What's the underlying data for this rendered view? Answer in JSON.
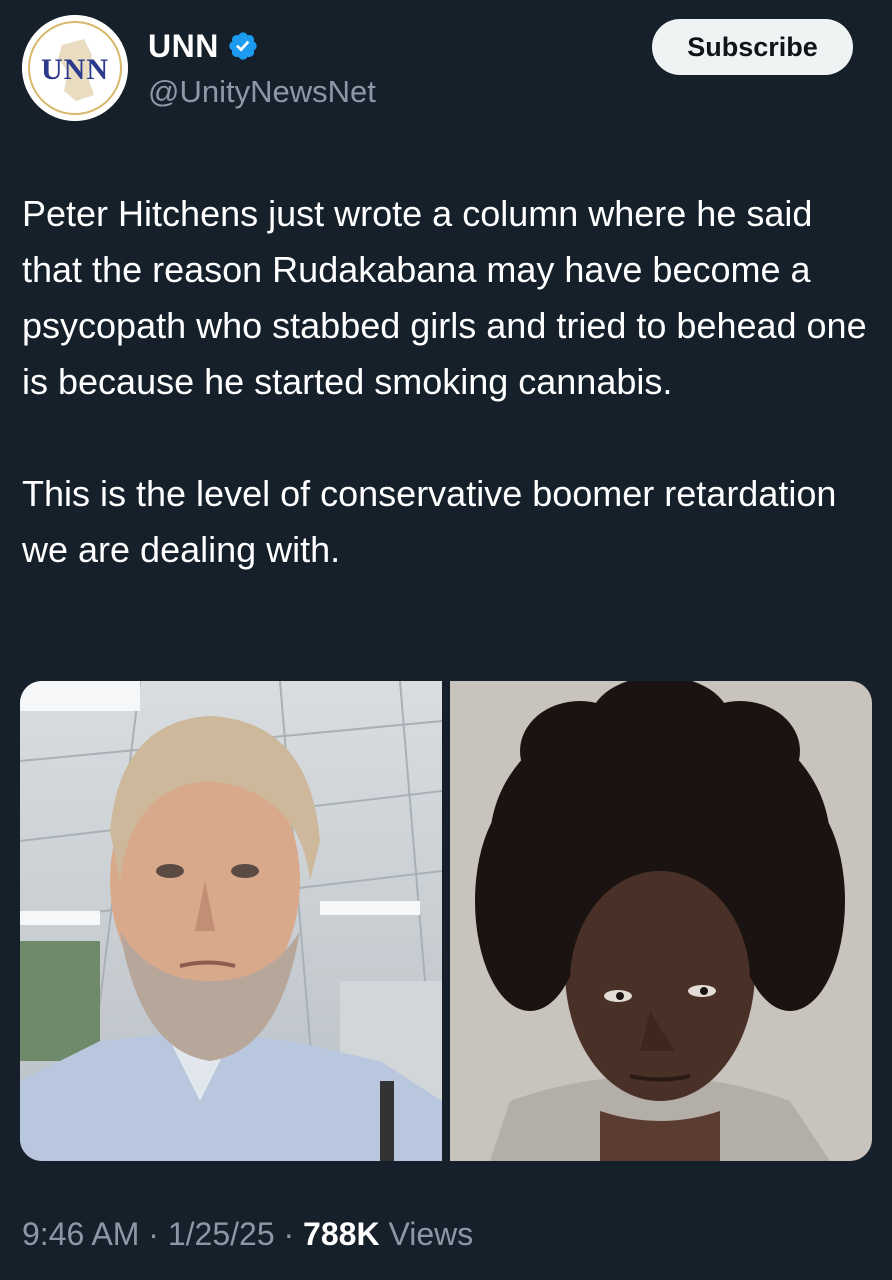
{
  "post": {
    "author": {
      "display_name": "UNN",
      "handle": "@UnityNewsNet",
      "verified": true,
      "avatar_logo_text": "UNN",
      "verified_badge_color": "#1d9bf0"
    },
    "subscribe_label": "Subscribe",
    "text": {
      "paragraph_1": "Peter Hitchens just wrote a column where he said that the reason Rudakabana may have become a psycopath who stabbed girls and tried to behead one is because he started smoking cannabis.",
      "paragraph_2": "This is the level of conservative boomer retardation we are dealing with."
    },
    "media": {
      "count": 2,
      "photos": [
        {
          "icon": "photo-man-office"
        },
        {
          "icon": "photo-mugshot"
        }
      ]
    },
    "meta": {
      "time": "9:46 AM",
      "separator": "·",
      "date": "1/25/25",
      "views_count": "788K",
      "views_label": "Views"
    }
  },
  "colors": {
    "background": "#15202b",
    "text_primary": "#ffffff",
    "text_secondary": "#8b98a5",
    "subscribe_bg": "#eff3f4"
  }
}
